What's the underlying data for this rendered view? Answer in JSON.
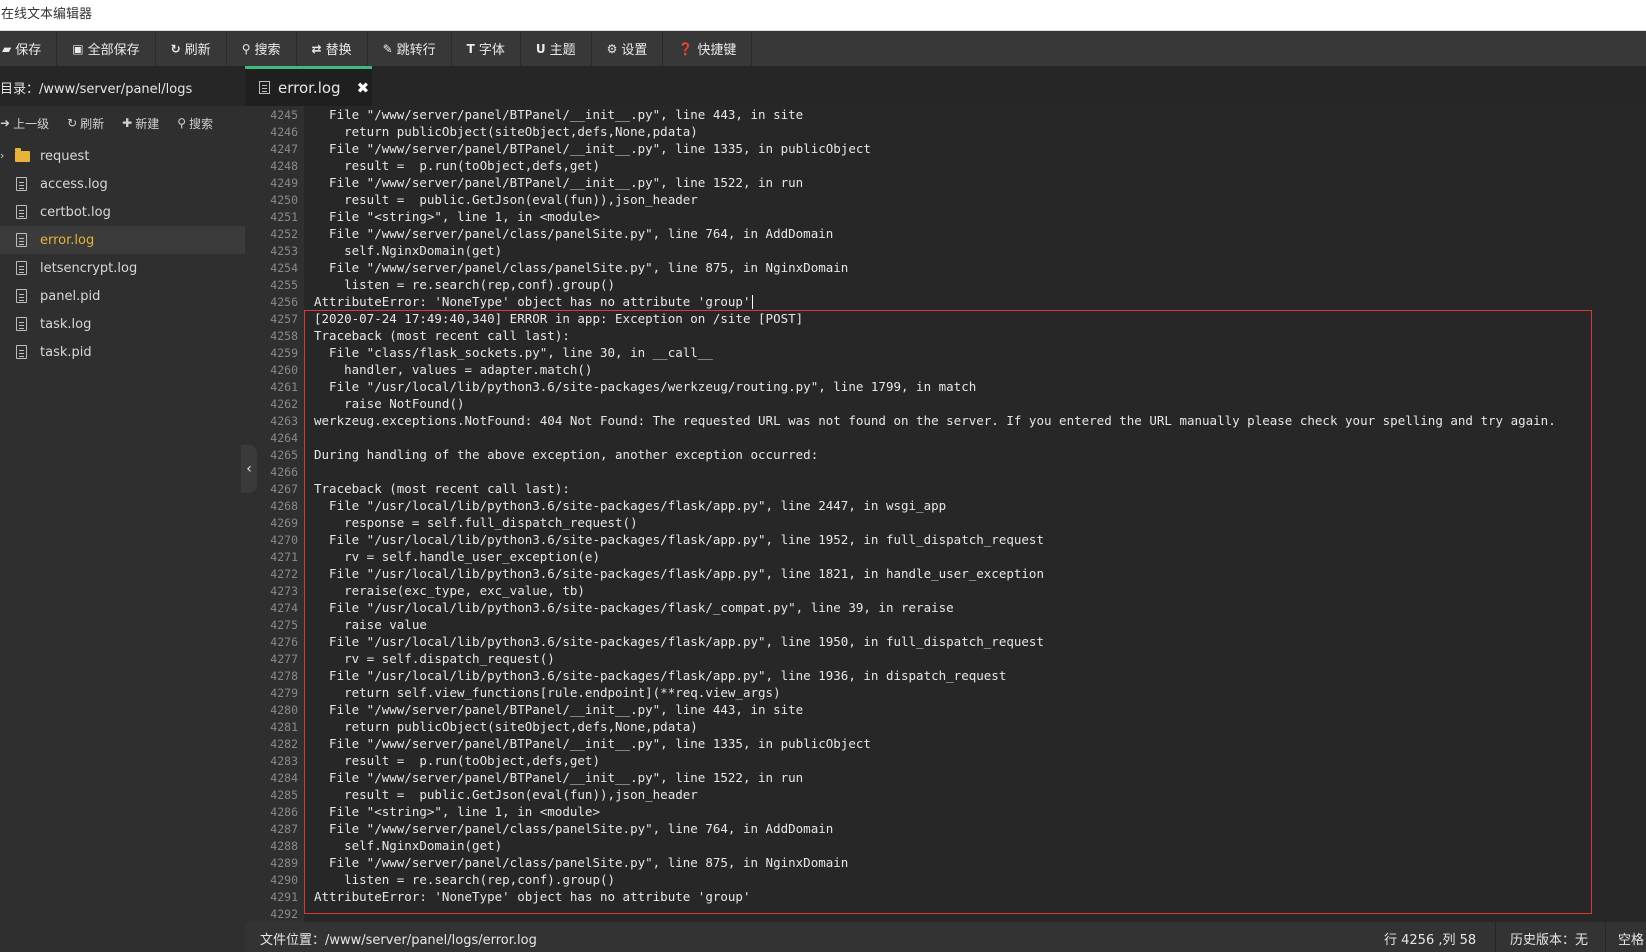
{
  "window": {
    "title": "在线文本编辑器"
  },
  "toolbar": [
    {
      "name": "save",
      "icon": "save-icon",
      "glyph": "▰",
      "label": "保存"
    },
    {
      "name": "save-all",
      "icon": "save-all-icon",
      "glyph": "▣",
      "label": "全部保存"
    },
    {
      "name": "refresh",
      "icon": "refresh-icon",
      "glyph": "↻",
      "label": "刷新"
    },
    {
      "name": "search",
      "icon": "search-icon",
      "glyph": "⚲",
      "label": "搜索"
    },
    {
      "name": "replace",
      "icon": "replace-icon",
      "glyph": "⇄",
      "label": "替换"
    },
    {
      "name": "goto-line",
      "icon": "pin-icon",
      "glyph": "✎",
      "label": "跳转行"
    },
    {
      "name": "font",
      "icon": "font-icon",
      "glyph": "T",
      "label": "字体"
    },
    {
      "name": "theme",
      "icon": "theme-icon",
      "glyph": "U",
      "label": "主题"
    },
    {
      "name": "settings",
      "icon": "gear-icon",
      "glyph": "⚙",
      "label": "设置"
    },
    {
      "name": "shortcuts",
      "icon": "help-icon",
      "glyph": "❓",
      "label": "快捷键"
    }
  ],
  "sidebar": {
    "directory_label": "目录：/www/server/panel/logs",
    "actions": [
      {
        "name": "up",
        "icon": "arrow-up-icon",
        "glyph": "➜",
        "label": "上一级"
      },
      {
        "name": "refresh",
        "icon": "refresh-icon",
        "glyph": "↻",
        "label": "刷新"
      },
      {
        "name": "new",
        "icon": "plus-icon",
        "glyph": "✚",
        "label": "新建"
      },
      {
        "name": "search",
        "icon": "search-icon",
        "glyph": "⚲",
        "label": "搜索"
      }
    ],
    "files": [
      {
        "name": "request",
        "type": "folder"
      },
      {
        "name": "access.log",
        "type": "file"
      },
      {
        "name": "certbot.log",
        "type": "file"
      },
      {
        "name": "error.log",
        "type": "file",
        "active": true
      },
      {
        "name": "letsencrypt.log",
        "type": "file"
      },
      {
        "name": "panel.pid",
        "type": "file"
      },
      {
        "name": "task.log",
        "type": "file"
      },
      {
        "name": "task.pid",
        "type": "file"
      }
    ]
  },
  "tab": {
    "label": "error.log",
    "close_glyph": "✖"
  },
  "editor": {
    "first_line": 4245,
    "cursor_line": 4256,
    "lines": [
      "  File \"/www/server/panel/BTPanel/__init__.py\", line 443, in site",
      "    return publicObject(siteObject,defs,None,pdata)",
      "  File \"/www/server/panel/BTPanel/__init__.py\", line 1335, in publicObject",
      "    result =  p.run(toObject,defs,get)",
      "  File \"/www/server/panel/BTPanel/__init__.py\", line 1522, in run",
      "    result =  public.GetJson(eval(fun)),json_header",
      "  File \"<string>\", line 1, in <module>",
      "  File \"/www/server/panel/class/panelSite.py\", line 764, in AddDomain",
      "    self.NginxDomain(get)",
      "  File \"/www/server/panel/class/panelSite.py\", line 875, in NginxDomain",
      "    listen = re.search(rep,conf).group()",
      "AttributeError: 'NoneType' object has no attribute 'group'",
      "[2020-07-24 17:49:40,340] ERROR in app: Exception on /site [POST]",
      "Traceback (most recent call last):",
      "  File \"class/flask_sockets.py\", line 30, in __call__",
      "    handler, values = adapter.match()",
      "  File \"/usr/local/lib/python3.6/site-packages/werkzeug/routing.py\", line 1799, in match",
      "    raise NotFound()",
      "werkzeug.exceptions.NotFound: 404 Not Found: The requested URL was not found on the server. If you entered the URL manually please check your spelling and try again.",
      "",
      "During handling of the above exception, another exception occurred:",
      "",
      "Traceback (most recent call last):",
      "  File \"/usr/local/lib/python3.6/site-packages/flask/app.py\", line 2447, in wsgi_app",
      "    response = self.full_dispatch_request()",
      "  File \"/usr/local/lib/python3.6/site-packages/flask/app.py\", line 1952, in full_dispatch_request",
      "    rv = self.handle_user_exception(e)",
      "  File \"/usr/local/lib/python3.6/site-packages/flask/app.py\", line 1821, in handle_user_exception",
      "    reraise(exc_type, exc_value, tb)",
      "  File \"/usr/local/lib/python3.6/site-packages/flask/_compat.py\", line 39, in reraise",
      "    raise value",
      "  File \"/usr/local/lib/python3.6/site-packages/flask/app.py\", line 1950, in full_dispatch_request",
      "    rv = self.dispatch_request()",
      "  File \"/usr/local/lib/python3.6/site-packages/flask/app.py\", line 1936, in dispatch_request",
      "    return self.view_functions[rule.endpoint](**req.view_args)",
      "  File \"/www/server/panel/BTPanel/__init__.py\", line 443, in site",
      "    return publicObject(siteObject,defs,None,pdata)",
      "  File \"/www/server/panel/BTPanel/__init__.py\", line 1335, in publicObject",
      "    result =  p.run(toObject,defs,get)",
      "  File \"/www/server/panel/BTPanel/__init__.py\", line 1522, in run",
      "    result =  public.GetJson(eval(fun)),json_header",
      "  File \"<string>\", line 1, in <module>",
      "  File \"/www/server/panel/class/panelSite.py\", line 764, in AddDomain",
      "    self.NginxDomain(get)",
      "  File \"/www/server/panel/class/panelSite.py\", line 875, in NginxDomain",
      "    listen = re.search(rep,conf).group()",
      "AttributeError: 'NoneType' object has no attribute 'group'",
      ""
    ]
  },
  "status": {
    "file_path": "文件位置：/www/server/panel/logs/error.log",
    "position": "行 4256 ,列 58",
    "history": "历史版本：无",
    "indent": "空格"
  },
  "colors": {
    "accent": "#3dbb7d",
    "highlight_border": "#d63b3b",
    "active_file": "#e8b33a"
  }
}
